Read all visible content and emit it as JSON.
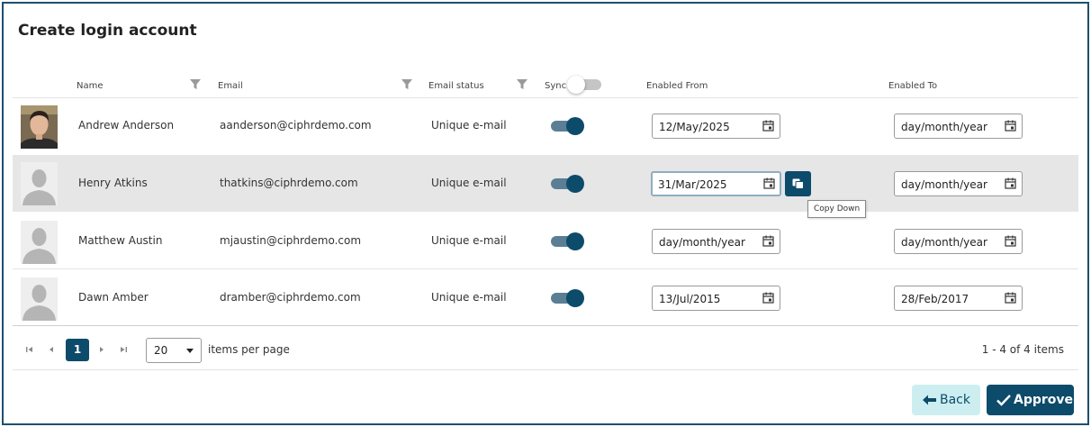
{
  "title": "Create login account",
  "columns": {
    "name": "Name",
    "email": "Email",
    "email_status": "Email status",
    "sync": "Sync",
    "enabled_from": "Enabled From",
    "enabled_to": "Enabled To"
  },
  "rows": [
    {
      "name": "Andrew Anderson",
      "email": "aanderson@ciphrdemo.com",
      "status": "Unique e-mail",
      "sync": true,
      "from": "12/May/2025",
      "to": "day/month/year",
      "photo": "person-photo"
    },
    {
      "name": "Henry Atkins",
      "email": "thatkins@ciphrdemo.com",
      "status": "Unique e-mail",
      "sync": true,
      "from": "31/Mar/2025",
      "to": "day/month/year",
      "photo": "placeholder-silhouette"
    },
    {
      "name": "Matthew Austin",
      "email": "mjaustin@ciphrdemo.com",
      "status": "Unique e-mail",
      "sync": true,
      "from": "day/month/year",
      "to": "day/month/year",
      "photo": "placeholder-silhouette"
    },
    {
      "name": "Dawn Amber",
      "email": "dramber@ciphrdemo.com",
      "status": "Unique e-mail",
      "sync": true,
      "from": "13/Jul/2015",
      "to": "28/Feb/2017",
      "photo": "placeholder-silhouette"
    }
  ],
  "copy_down": {
    "tooltip": "Copy Down",
    "icon": "copy-icon"
  },
  "pager": {
    "current_page": "1",
    "page_size": "20",
    "page_size_label": "items per page",
    "count_label": "1 - 4 of 4 items"
  },
  "buttons": {
    "back": "Back",
    "approve": "Approve"
  },
  "colors": {
    "primary": "#0d4b6b",
    "toggle_track_on": "#5a7f94",
    "back_bg": "#cdeef0",
    "frame_border": "#1d4f6e",
    "selected_row_bg": "#e6e6e6"
  }
}
